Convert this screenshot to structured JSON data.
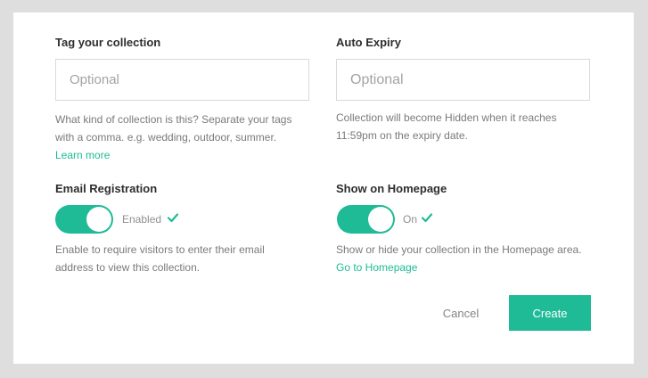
{
  "tags": {
    "label": "Tag your collection",
    "placeholder": "Optional",
    "help": "What kind of collection is this? Separate your tags with a comma. e.g. wedding, outdoor, summer.",
    "learn_more": "Learn more"
  },
  "expiry": {
    "label": "Auto Expiry",
    "placeholder": "Optional",
    "help": "Collection will become Hidden when it reaches 11:59pm on the expiry date."
  },
  "email_registration": {
    "label": "Email Registration",
    "state": "Enabled",
    "help": "Enable to require visitors to enter their email address to view this collection."
  },
  "homepage": {
    "label": "Show on Homepage",
    "state": "On",
    "help": "Show or hide your collection in the Homepage area.",
    "link": "Go to Homepage"
  },
  "actions": {
    "cancel": "Cancel",
    "create": "Create"
  },
  "colors": {
    "accent": "#1fbb96",
    "background": "#dedede",
    "panel": "#ffffff"
  },
  "icons": {
    "check": "check-icon"
  }
}
